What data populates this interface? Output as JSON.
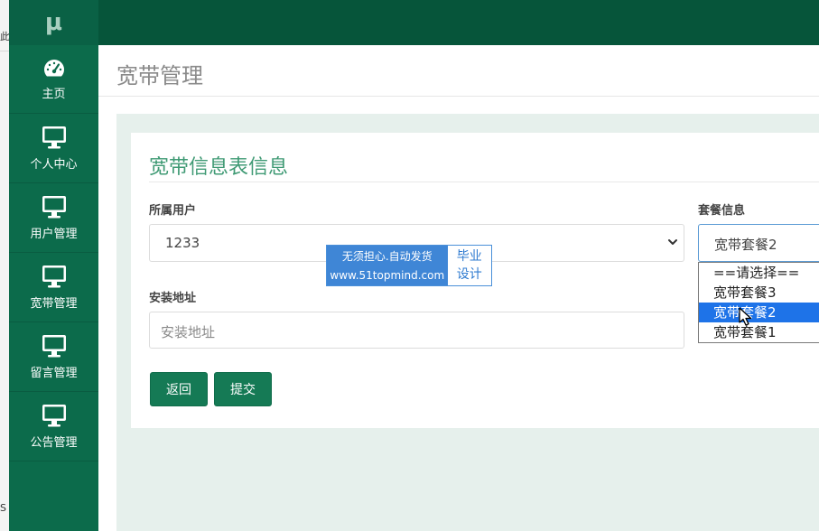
{
  "left_fragments": [
    "此",
    "S"
  ],
  "sidebar": {
    "logo": "μ",
    "items": [
      {
        "label": "主页",
        "icon": "dashboard-icon"
      },
      {
        "label": "个人中心",
        "icon": "monitor-icon"
      },
      {
        "label": "用户管理",
        "icon": "monitor-icon"
      },
      {
        "label": "宽带管理",
        "icon": "monitor-icon"
      },
      {
        "label": "留言管理",
        "icon": "monitor-icon"
      },
      {
        "label": "公告管理",
        "icon": "monitor-icon"
      }
    ]
  },
  "page": {
    "title": "宽带管理"
  },
  "card": {
    "title": "宽带信息表信息",
    "user_label": "所属用户",
    "user_value": "1233",
    "package_label": "套餐信息",
    "package_value": "宽带套餐2",
    "address_label": "安装地址",
    "address_placeholder": "安装地址",
    "back_button": "返回",
    "submit_button": "提交"
  },
  "dropdown": {
    "options": [
      "==请选择==",
      "宽带套餐3",
      "宽带套餐2",
      "宽带套餐1"
    ],
    "selected_index": 2
  },
  "watermark": {
    "line1": "无须担心.自动发货",
    "line2": "www.51topmind.com",
    "right1": "毕业",
    "right2": "设计"
  },
  "colors": {
    "sidebar": "#0c6b4b",
    "topbar": "#06553a",
    "accent": "#3f9a74",
    "button": "#157a55",
    "selected_option": "#1e73e8"
  }
}
